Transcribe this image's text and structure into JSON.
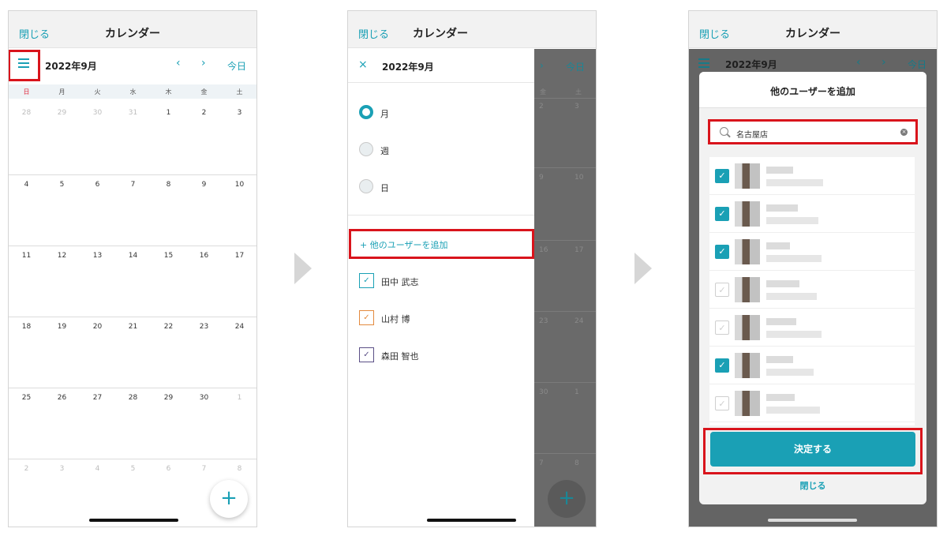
{
  "panel1": {
    "close_label": "閉じる",
    "title": "カレンダー",
    "month": "2022年9月",
    "prev_icon": "‹",
    "next_icon": "›",
    "today_label": "今日",
    "weekdays": [
      "日",
      "月",
      "火",
      "水",
      "木",
      "金",
      "土"
    ],
    "weeks": [
      [
        "28",
        "29",
        "30",
        "31",
        "1",
        "2",
        "3"
      ],
      [
        "4",
        "5",
        "6",
        "7",
        "8",
        "9",
        "10"
      ],
      [
        "11",
        "12",
        "13",
        "14",
        "15",
        "16",
        "17"
      ],
      [
        "18",
        "19",
        "20",
        "21",
        "22",
        "23",
        "24"
      ],
      [
        "25",
        "26",
        "27",
        "28",
        "29",
        "30",
        "1"
      ],
      [
        "2",
        "3",
        "4",
        "5",
        "6",
        "7",
        "8"
      ]
    ],
    "fab_icon": "+",
    "sunday_color": "#e0283c"
  },
  "panel2": {
    "close_label": "閉じる",
    "title": "カレンダー",
    "drawer_close_icon": "×",
    "month": "2022年9月",
    "views": [
      {
        "label": "月",
        "selected": true
      },
      {
        "label": "週",
        "selected": false
      },
      {
        "label": "日",
        "selected": false
      }
    ],
    "add_user_label": "+ 他のユーザーを追加",
    "users": [
      {
        "name": "田中 武志",
        "color": "#1aa0b5"
      },
      {
        "name": "山村 博",
        "color": "#e38a3e"
      },
      {
        "name": "森田 智也",
        "color": "#5b4f86"
      }
    ],
    "bg_today_label": "今日",
    "bg_next_icon": "›",
    "bg_weekdays": [
      "金",
      "土"
    ],
    "bg_days": [
      [
        "2",
        "3"
      ],
      [
        "9",
        "10"
      ],
      [
        "16",
        "17"
      ],
      [
        "23",
        "24"
      ],
      [
        "30",
        "1"
      ],
      [
        "7",
        "8"
      ]
    ],
    "fab_icon": "+"
  },
  "panel3": {
    "close_label": "閉じる",
    "title": "カレンダー",
    "bg_month": "2022年9月",
    "bg_prev_icon": "‹",
    "bg_next_icon": "›",
    "bg_today_label": "今日",
    "modal_title": "他のユーザーを追加",
    "search_value": "名古屋店",
    "users_checked": [
      true,
      true,
      true,
      false,
      false,
      true,
      false
    ],
    "confirm_label": "決定する",
    "modal_close_label": "閉じる"
  },
  "colors": {
    "accent": "#1aa0b5",
    "highlight": "#d9141c"
  }
}
